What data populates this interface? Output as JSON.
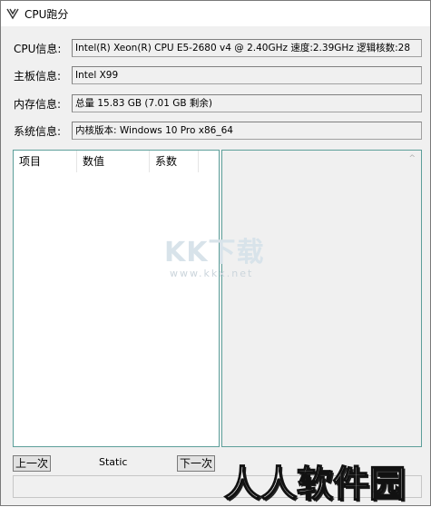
{
  "window": {
    "title": "CPU跑分"
  },
  "info": {
    "cpu": {
      "label": "CPU信息:",
      "value": "Intel(R) Xeon(R) CPU E5-2680 v4 @ 2.40GHz 速度:2.39GHz 逻辑核数:28"
    },
    "board": {
      "label": "主板信息:",
      "value": "Intel X99"
    },
    "memory": {
      "label": "内存信息:",
      "value": "总量 15.83 GB (7.01 GB 剩余)"
    },
    "system": {
      "label": "系统信息:",
      "value": "内核版本: Windows 10 Pro x86_64"
    }
  },
  "list": {
    "columns": [
      "项目",
      "数值",
      "系数"
    ]
  },
  "controls": {
    "prev_label": "上一次",
    "status": "Static",
    "next_label": "下一次"
  },
  "watermarks": {
    "center": "KK下载",
    "url": "www.kkx.net",
    "corner": "人人软件园"
  },
  "colors": {
    "panel_border": "#5d9f9a",
    "window_bg": "#f0f0f0"
  }
}
